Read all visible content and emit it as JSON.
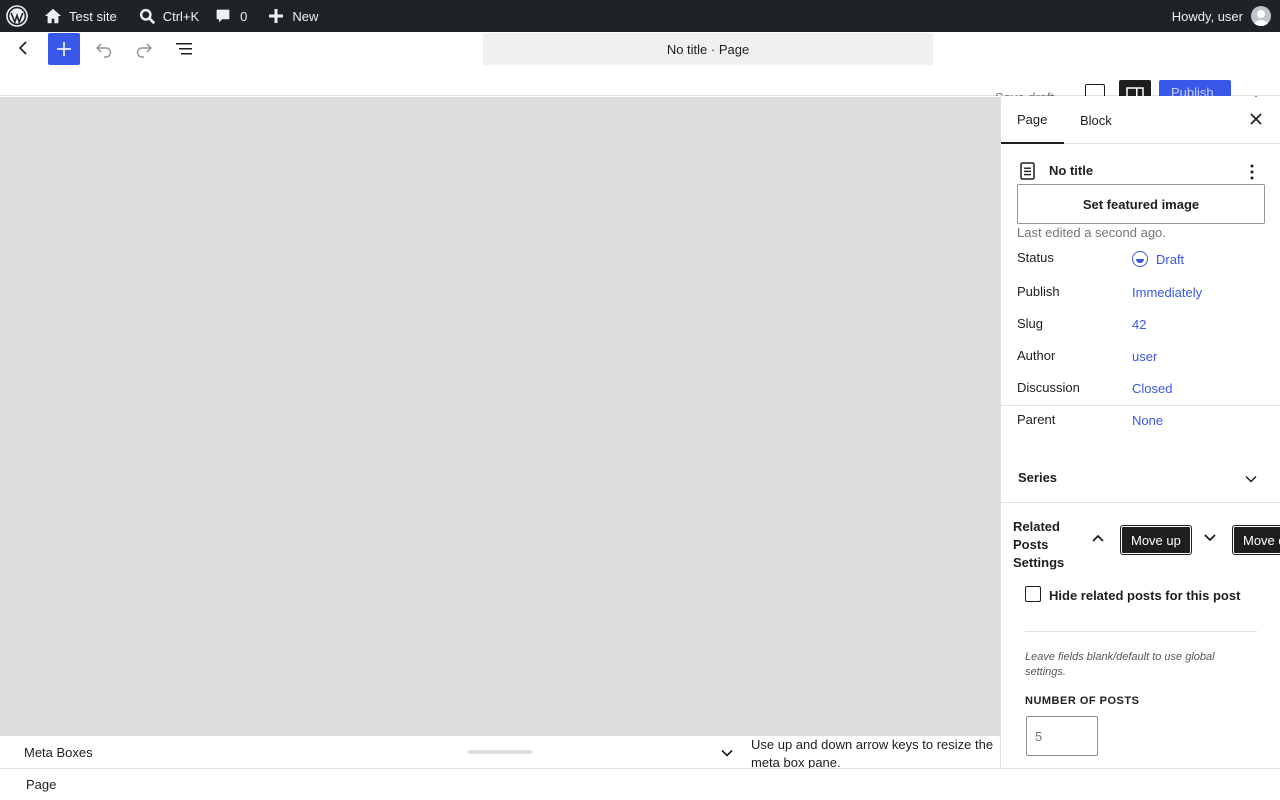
{
  "adminbar": {
    "site_name": "Test site",
    "search_shortcut": "Ctrl+K",
    "comments_count": "0",
    "new_label": "New",
    "greeting": "Howdy, user"
  },
  "header": {
    "document_title": "No title · Page",
    "save_draft": "Save draft",
    "publish": "Publish"
  },
  "sidebar": {
    "tabs": [
      {
        "label": "Page"
      },
      {
        "label": "Block"
      }
    ],
    "post": {
      "title": "No title",
      "featured_image_button": "Set featured image",
      "last_edited": "Last edited a second ago."
    },
    "fields": [
      {
        "label": "Status",
        "value": "Draft"
      },
      {
        "label": "Publish",
        "value": "Immediately"
      },
      {
        "label": "Slug",
        "value": "42"
      },
      {
        "label": "Author",
        "value": "user"
      },
      {
        "label": "Discussion",
        "value": "Closed"
      },
      {
        "label": "Parent",
        "value": "None"
      }
    ],
    "series": {
      "title": "Series"
    },
    "related": {
      "title": "Related Posts Settings",
      "move_up": "Move up",
      "move_down": "Move down",
      "hide_label": "Hide related posts for this post",
      "help": "Leave fields blank/default to use global settings.",
      "number_label": "NUMBER OF POSTS",
      "number_placeholder": "5"
    }
  },
  "metabox": {
    "title": "Meta Boxes",
    "hint": "Use up and down arrow keys to resize the meta box pane."
  },
  "footer": {
    "breadcrumb": "Page"
  },
  "colors": {
    "accent": "#3858e9",
    "adminbar": "#1d2327",
    "canvas": "#dddddd"
  }
}
